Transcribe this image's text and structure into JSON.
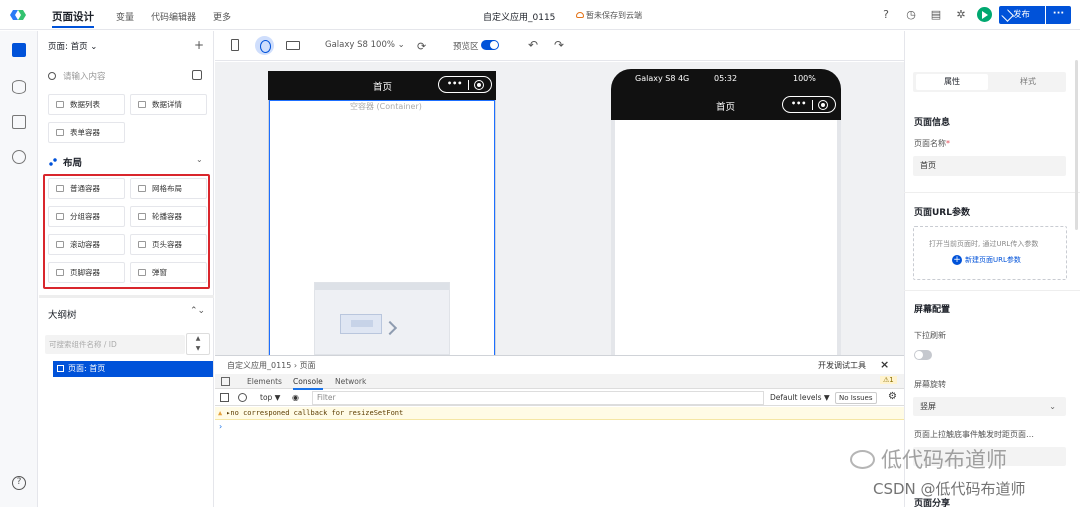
{
  "topbar": {
    "brand": "页面设计",
    "nav": [
      "变量",
      "代码编辑器",
      "更多"
    ],
    "app_name": "自定义应用_0115",
    "save_status": "暂未保存到云端",
    "publish_label": "发布",
    "more_label": "···"
  },
  "left": {
    "page_selector": "页面: 首页 ⌄",
    "add": "+",
    "search_placeholder": "请输入内容",
    "data_components": [
      "数据列表",
      "数据详情",
      "表单容器"
    ],
    "layout_title": "布局",
    "layout_components": [
      "普通容器",
      "网格布局",
      "分组容器",
      "轮播容器",
      "滚动容器",
      "页头容器",
      "页脚容器",
      "弹窗"
    ],
    "outline_title": "大纲树",
    "outline_search_placeholder": "可搜索组件名称 / ID",
    "outline_node": "页面: 首页"
  },
  "device_bar": {
    "device_name": "Galaxy S8 100% ⌄",
    "preview_label": "预览区"
  },
  "canvas": {
    "phone1_title": "首页",
    "container_label": "空容器 (Container)",
    "phone2_carrier": "Galaxy S8 4G",
    "phone2_time": "05:32",
    "phone2_battery": "100%",
    "phone2_title": "首页",
    "capsule_dots": "•••"
  },
  "devtools": {
    "breadcrumb": "自定义应用_0115 › 页面",
    "open_label": "开发调试工具",
    "close": "×",
    "tabs": [
      "Elements",
      "Console",
      "Network"
    ],
    "warn_count": "⚠1",
    "context": "top ▼",
    "filter_placeholder": "Filter",
    "levels": "Default levels ▼",
    "issues": "No Issues",
    "warning_message": "▸no corresponed callback for resizeSetFont",
    "prompt": "›"
  },
  "right": {
    "tab_attr": "属性",
    "tab_style": "样式",
    "page_info_title": "页面信息",
    "page_name_label": "页面名称",
    "page_name_value": "首页",
    "url_params_title": "页面URL参数",
    "url_hint": "打开当前页面时, 通过URL传入参数",
    "url_new": "新建页面URL参数",
    "screen_title": "屏幕配置",
    "pull_refresh_label": "下拉刷新",
    "rotation_label": "屏幕旋转",
    "rotation_value": "竖屏",
    "distance_label": "页面上拉触底事件触发时距页面…",
    "share_title": "页面分享"
  },
  "watermark": {
    "line1": "低代码布道师",
    "line2": "CSDN @低代码布道师"
  }
}
